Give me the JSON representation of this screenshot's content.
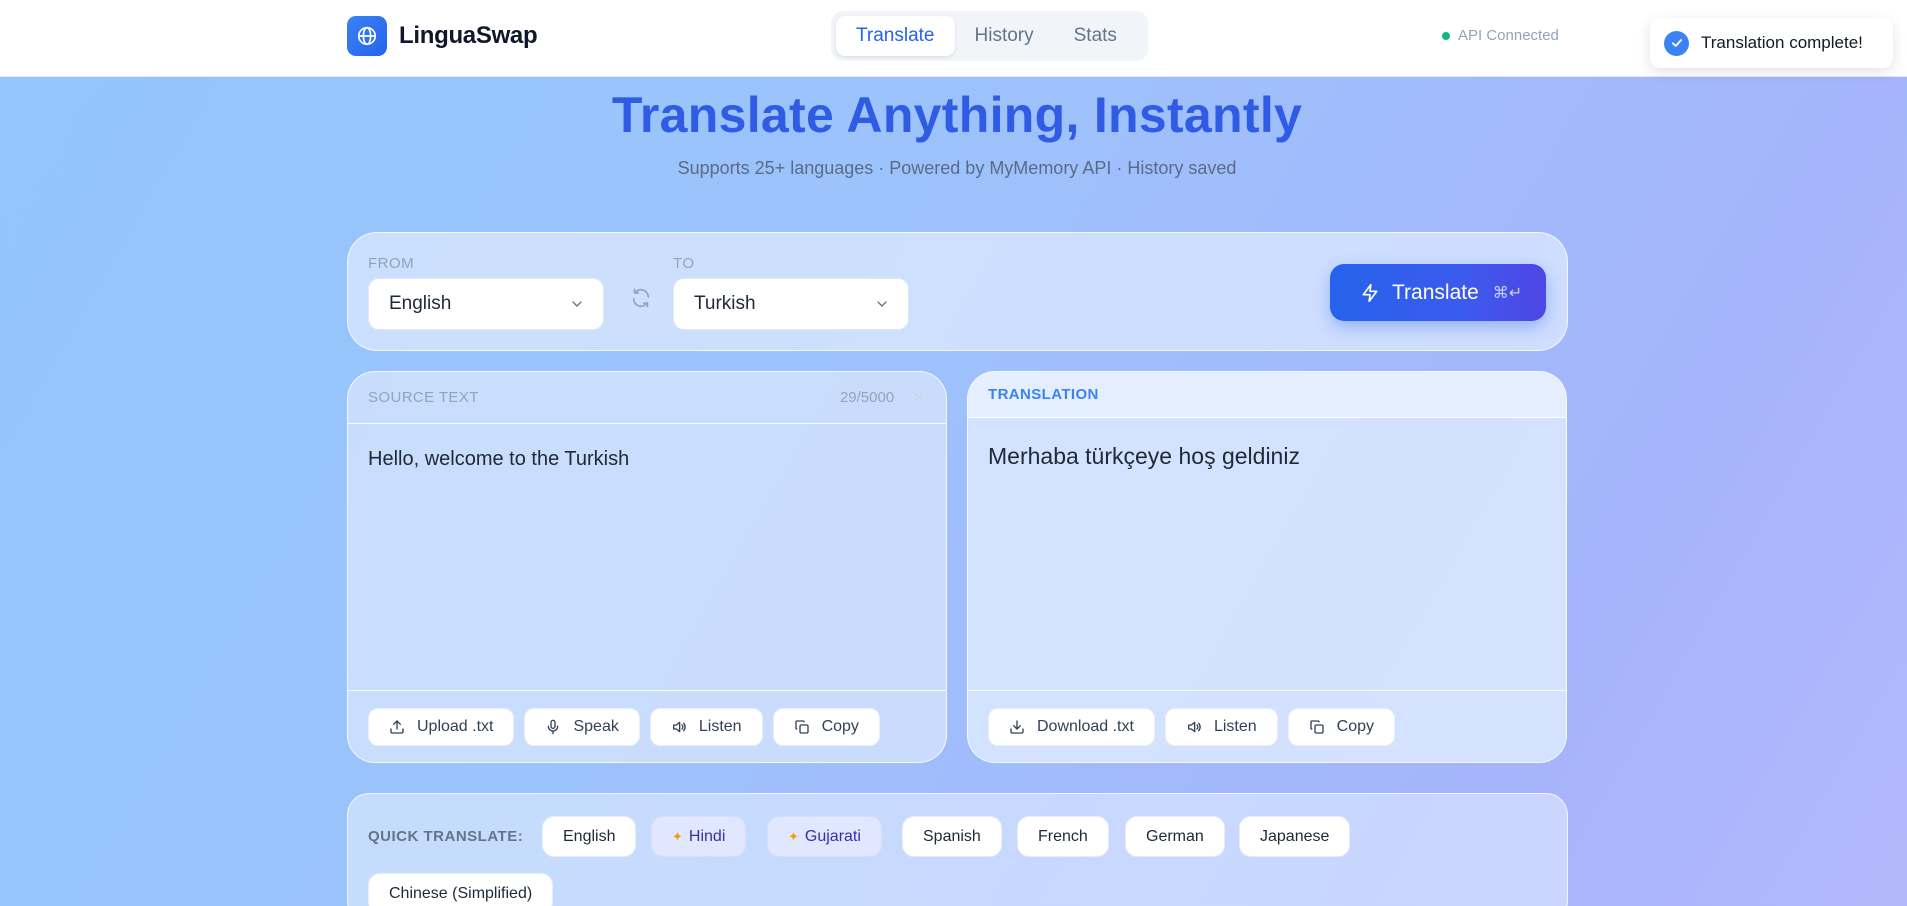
{
  "header": {
    "brand": "LinguaSwap",
    "tabs": [
      {
        "label": "Translate",
        "active": true
      },
      {
        "label": "History",
        "active": false
      },
      {
        "label": "Stats",
        "active": false
      }
    ],
    "api_status": "API Connected"
  },
  "toast": {
    "message": "Translation complete!"
  },
  "hero": {
    "title": "Translate Anything, Instantly",
    "subtitle": "Supports 25+ languages · Powered by MyMemory API · History saved"
  },
  "controls": {
    "from_label": "FROM",
    "from_value": "English",
    "to_label": "TO",
    "to_value": "Turkish",
    "translate_label": "Translate",
    "shortcut": "⌘↵"
  },
  "source": {
    "header": "SOURCE TEXT",
    "char_count": "29/5000",
    "text": "Hello, welcome to the Turkish",
    "actions": [
      "Upload .txt",
      "Speak",
      "Listen",
      "Copy"
    ]
  },
  "translation": {
    "header": "TRANSLATION",
    "text": "Merhaba türkçeye hoş geldiniz",
    "actions": [
      "Download .txt",
      "Listen",
      "Copy"
    ]
  },
  "quick": {
    "label": "QUICK TRANSLATE:",
    "chips": [
      "English",
      "Hindi",
      "Gujarati",
      "Spanish",
      "French",
      "German",
      "Japanese",
      "Chinese (Simplified)"
    ]
  },
  "colors": {
    "accent": "#2563eb",
    "title": "#2f5be5",
    "status_ok": "#10b981"
  }
}
